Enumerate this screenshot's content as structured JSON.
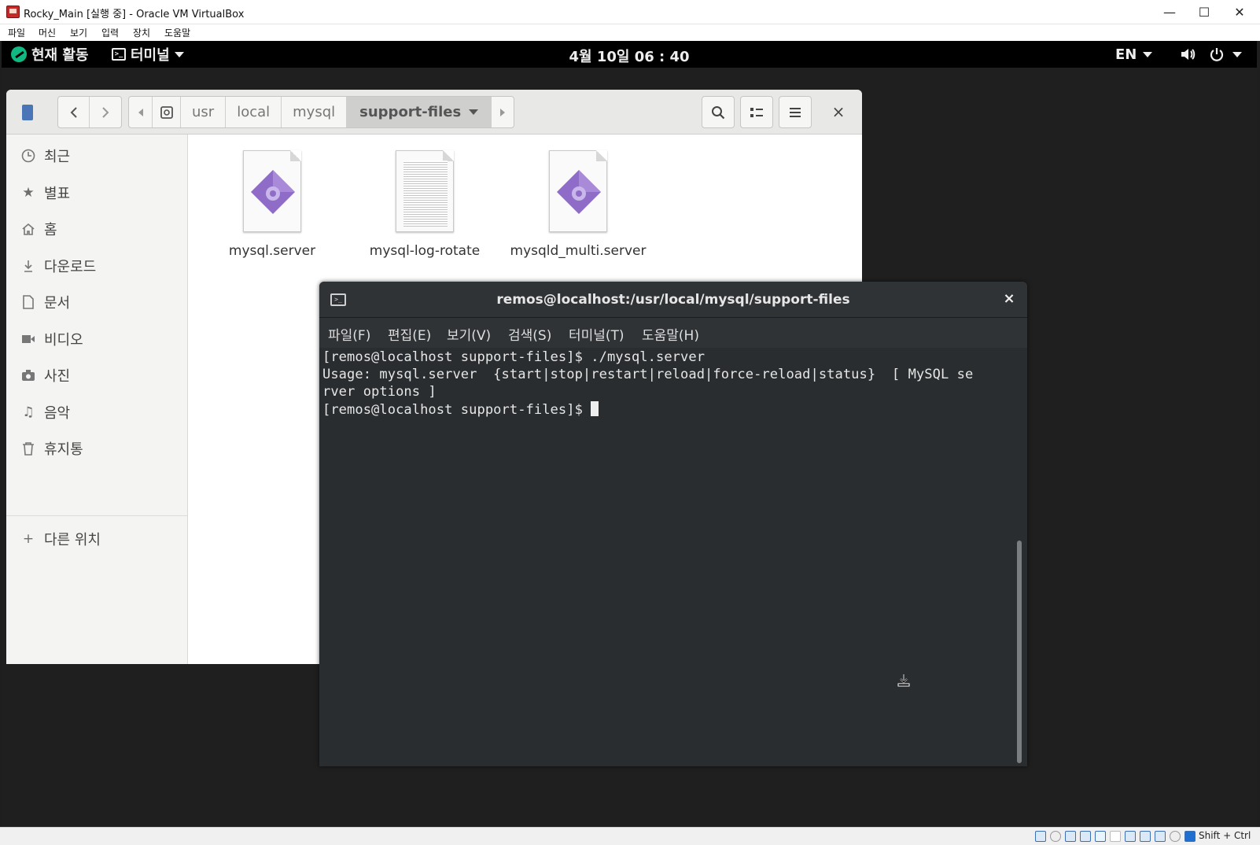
{
  "vbox": {
    "title": "Rocky_Main [실행 중] - Oracle VM VirtualBox",
    "menu": [
      "파일",
      "머신",
      "보기",
      "입력",
      "장치",
      "도움말"
    ],
    "window_controls": {
      "minimize": "—",
      "maximize": "☐",
      "close": "✕"
    },
    "host_key": "Shift + Ctrl"
  },
  "gnome": {
    "activities": "현재 활동",
    "app_menu": "터미널",
    "clock": "4월 10일  06 : 40",
    "language": "EN"
  },
  "files": {
    "breadcrumbs": [
      "usr",
      "local",
      "mysql"
    ],
    "current_folder": "support-files",
    "close": "×",
    "sidebar": [
      {
        "label": "최근",
        "icon": "clock-icon"
      },
      {
        "label": "별표",
        "icon": "star-icon"
      },
      {
        "label": "홈",
        "icon": "home-icon"
      },
      {
        "label": "다운로드",
        "icon": "download-icon"
      },
      {
        "label": "문서",
        "icon": "document-icon"
      },
      {
        "label": "비디오",
        "icon": "video-icon"
      },
      {
        "label": "사진",
        "icon": "camera-icon"
      },
      {
        "label": "음악",
        "icon": "music-icon"
      },
      {
        "label": "휴지통",
        "icon": "trash-icon"
      }
    ],
    "other_locations": "다른 위치",
    "items": [
      {
        "name": "mysql.server",
        "type": "script"
      },
      {
        "name": "mysql-log-rotate",
        "type": "text"
      },
      {
        "name": "mysqld_multi.server",
        "type": "script"
      }
    ]
  },
  "terminal": {
    "title": "remos@localhost:/usr/local/mysql/support-files",
    "close": "×",
    "menu": [
      "파일(F)",
      "편집(E)",
      "보기(V)",
      "검색(S)",
      "터미널(T)",
      "도움말(H)"
    ],
    "lines": [
      "[remos@localhost support-files]$ ./mysql.server",
      "Usage: mysql.server  {start|stop|restart|reload|force-reload|status}  [ MySQL se",
      "rver options ]",
      "[remos@localhost support-files]$ "
    ]
  },
  "colors": {
    "terminal_bg": "#292d2f",
    "gnome_topbar": "#000000",
    "script_icon": "#8e6cc8"
  }
}
